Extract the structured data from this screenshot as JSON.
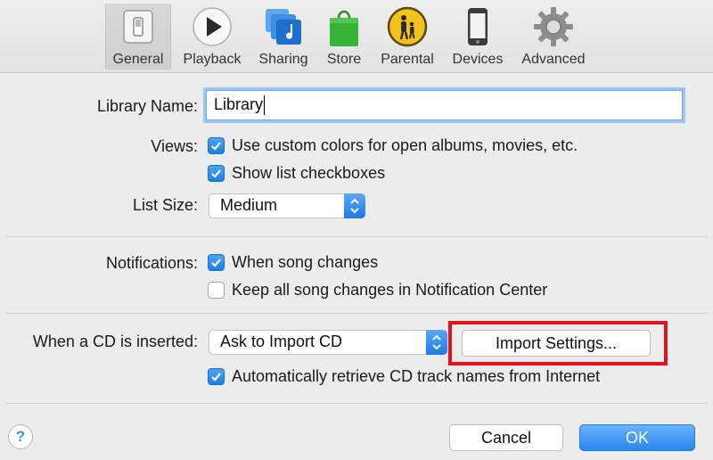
{
  "toolbar": {
    "items": [
      {
        "label": "General",
        "icon": "general-switch-icon",
        "selected": true
      },
      {
        "label": "Playback",
        "icon": "play-icon"
      },
      {
        "label": "Sharing",
        "icon": "sharing-music-icon"
      },
      {
        "label": "Store",
        "icon": "store-bag-icon"
      },
      {
        "label": "Parental",
        "icon": "parental-icon"
      },
      {
        "label": "Devices",
        "icon": "devices-phone-icon"
      },
      {
        "label": "Advanced",
        "icon": "gear-icon"
      }
    ]
  },
  "general": {
    "library_name_label": "Library Name:",
    "library_name_value": "Library",
    "views_label": "Views:",
    "custom_colors_label": "Use custom colors for open albums, movies, etc.",
    "custom_colors_checked": true,
    "list_checkboxes_label": "Show list checkboxes",
    "list_checkboxes_checked": true,
    "list_size_label": "List Size:",
    "list_size_value": "Medium",
    "notifications_label": "Notifications:",
    "song_changes_label": "When song changes",
    "song_changes_checked": true,
    "keep_changes_label": "Keep all song changes in Notification Center",
    "keep_changes_checked": false,
    "cd_inserted_label": "When a CD is inserted:",
    "cd_action_value": "Ask to Import CD",
    "import_settings_label": "Import Settings...",
    "retrieve_names_label": "Automatically retrieve CD track names from Internet",
    "retrieve_names_checked": true
  },
  "footer": {
    "help_label": "?",
    "cancel_label": "Cancel",
    "ok_label": "OK"
  },
  "colors": {
    "accent": "#1a7ee8",
    "highlight_box": "#e0141e"
  }
}
